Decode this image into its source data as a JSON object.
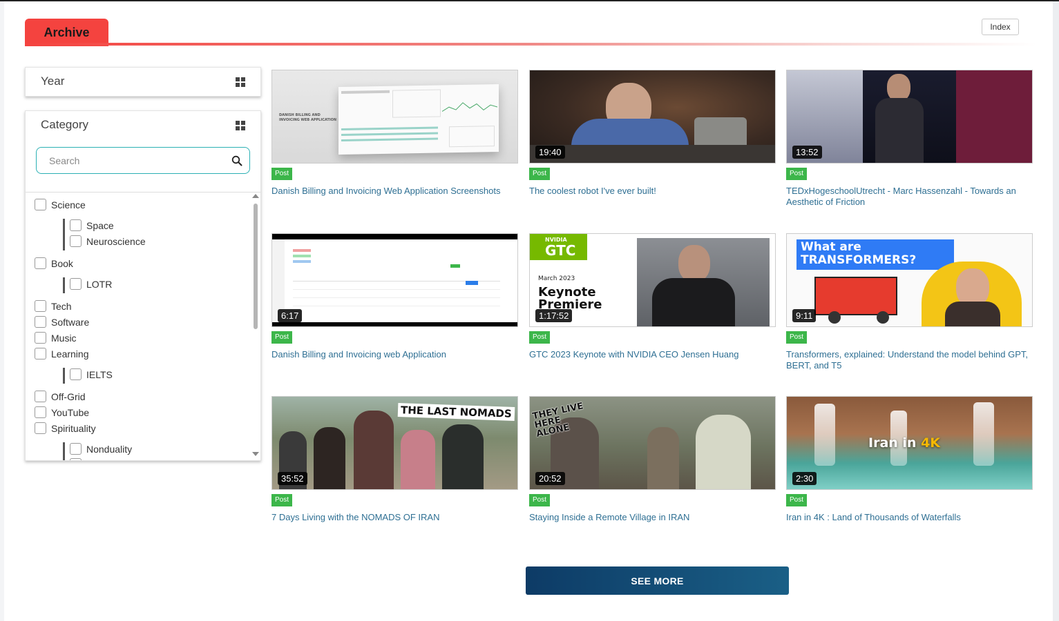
{
  "header": {
    "archive_label": "Archive",
    "index_label": "Index"
  },
  "filters": {
    "year_title": "Year",
    "category_title": "Category",
    "search_placeholder": "Search",
    "categories": [
      {
        "label": "Science",
        "level": 0
      },
      {
        "label": "Space",
        "level": 1
      },
      {
        "label": "Neuroscience",
        "level": 1
      },
      {
        "label": "Book",
        "level": 0
      },
      {
        "label": "LOTR",
        "level": 1
      },
      {
        "label": "Tech",
        "level": 0
      },
      {
        "label": "Software",
        "level": 0
      },
      {
        "label": "Music",
        "level": 0
      },
      {
        "label": "Learning",
        "level": 0
      },
      {
        "label": "IELTS",
        "level": 1
      },
      {
        "label": "Off-Grid",
        "level": 0
      },
      {
        "label": "YouTube",
        "level": 0
      },
      {
        "label": "Spirituality",
        "level": 0
      },
      {
        "label": "Nonduality",
        "level": 1
      }
    ]
  },
  "cards": [
    {
      "badge": "Post",
      "duration": "",
      "title": "Danish Billing and Invoicing Web Application Screenshots",
      "thumb_caption": "DANISH BILLING AND INVOICING WEB APPLICATION"
    },
    {
      "badge": "Post",
      "duration": "19:40",
      "title": "The coolest robot I've ever built!"
    },
    {
      "badge": "Post",
      "duration": "13:52",
      "title": "TEDxHogeschoolUtrecht - Marc Hassenzahl - Towards an Aesthetic of Friction"
    },
    {
      "badge": "Post",
      "duration": "6:17",
      "title": "Danish Billing and Invoicing web Application"
    },
    {
      "badge": "Post",
      "duration": "1:17:52",
      "title": "GTC 2023 Keynote with NVIDIA CEO Jensen Huang",
      "thumb_logo": "GTC",
      "thumb_brand": "NVIDIA",
      "thumb_date": "March 2023",
      "thumb_line1": "Keynote",
      "thumb_line2": "Premiere"
    },
    {
      "badge": "Post",
      "duration": "9:11",
      "title": "Transformers, explained: Understand the model behind GPT, BERT, and T5",
      "thumb_line1": "What are",
      "thumb_line2": "TRANSFORMERS?"
    },
    {
      "badge": "Post",
      "duration": "35:52",
      "title": "7 Days Living with the NOMADS OF IRAN",
      "thumb_caption": "THE LAST NOMADS"
    },
    {
      "badge": "Post",
      "duration": "20:52",
      "title": "Staying Inside a Remote Village in IRAN",
      "thumb_caption": "THEY LIVE HERE ALONE"
    },
    {
      "badge": "Post",
      "duration": "2:30",
      "title": "Iran in 4K : Land of Thousands of Waterfalls",
      "thumb_caption": "Iran in",
      "thumb_accent": "4K"
    }
  ],
  "see_more_label": "SEE MORE",
  "colors": {
    "accent": "#f4433f",
    "badge": "#3cb64a",
    "link": "#2e6f93",
    "search_border": "#2bb0b4",
    "button": "#0d3b66"
  },
  "icons": {
    "year_toggle": "grid-icon",
    "category_toggle": "grid-icon",
    "search": "search-icon"
  }
}
